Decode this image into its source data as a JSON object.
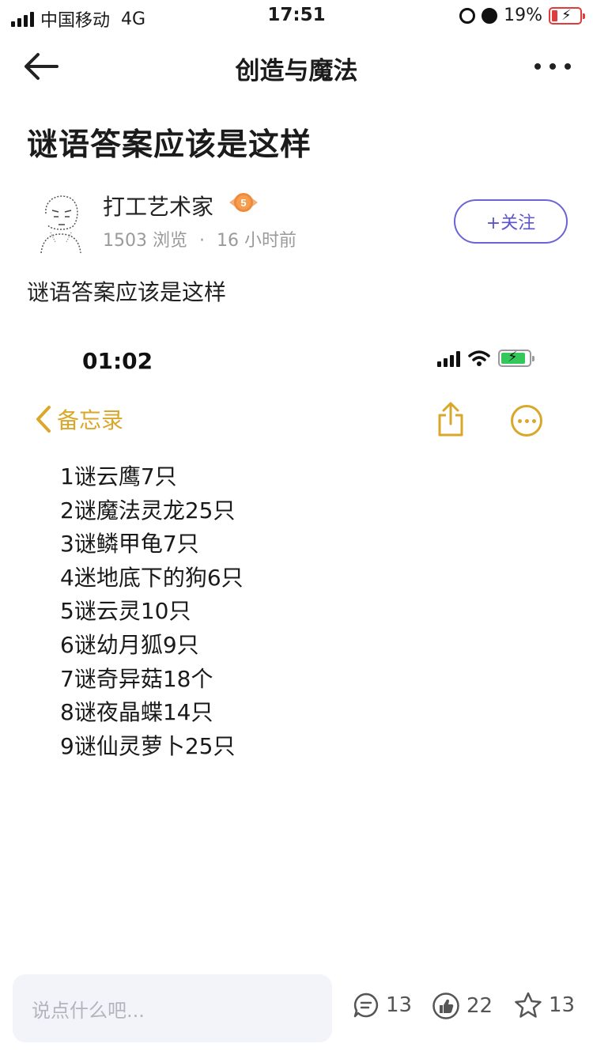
{
  "status_bar": {
    "carrier": "中国移动",
    "network": "4G",
    "time": "17:51",
    "battery_percent": "19%",
    "battery_color": "#e23b3b"
  },
  "nav": {
    "title": "创造与魔法",
    "back_icon": "arrow-left-icon",
    "more_icon": "more-dots-icon"
  },
  "post": {
    "title": "谜语答案应该是这样",
    "body": "谜语答案应该是这样"
  },
  "author": {
    "name": "打工艺术家",
    "level": "5",
    "views": "1503 浏览",
    "separator": "·",
    "time_ago": "16 小时前",
    "follow_label": "+关注",
    "accent_color": "#6b63d6"
  },
  "screenshot": {
    "time": "01:02",
    "memo_back_label": "备忘录",
    "accent_color": "#d9a72a",
    "items": [
      "1谜云鹰7只",
      "2谜魔法灵龙25只",
      "3谜鳞甲龟7只",
      "4迷地底下的狗6只",
      "5谜云灵10只",
      "6谜幼月狐9只",
      "7谜奇异菇18个",
      "8谜夜晶蝶14只",
      "9谜仙灵萝卜25只"
    ]
  },
  "bottom_bar": {
    "comment_placeholder": "说点什么吧...",
    "comments_count": "13",
    "likes_count": "22",
    "favorites_count": "13"
  }
}
